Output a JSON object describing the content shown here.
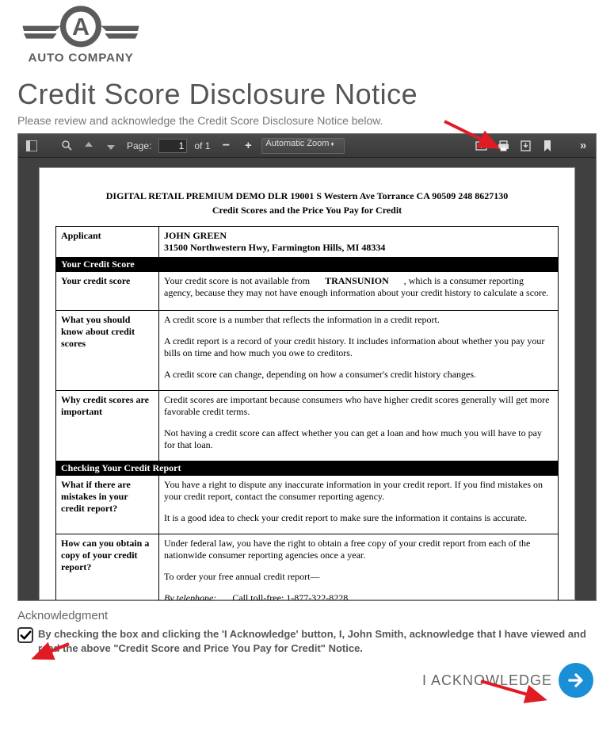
{
  "brand": {
    "name": "AUTO COMPANY"
  },
  "page": {
    "title": "Credit Score Disclosure Notice",
    "subtitle": "Please review and acknowledge the Credit Score Disclosure Notice below."
  },
  "pdfToolbar": {
    "pageLabel": "Page:",
    "pageCurrent": "1",
    "pageOf": "of 1",
    "zoom": "Automatic Zoom"
  },
  "doc": {
    "header1": "DIGITAL RETAIL PREMIUM DEMO DLR 19001 S Western Ave Torrance CA 90509 248 8627130",
    "header2": "Credit Scores and the Price You Pay for Credit",
    "applicantLabel": "Applicant",
    "applicantName": "JOHN GREEN",
    "applicantAddr": "31500 Northwestern Hwy, Farmington Hills, MI 48334",
    "section1": "Your Credit Score",
    "r1Label": "Your credit score",
    "r1p1a": "Your credit score is not available from ",
    "r1Agency": "TRANSUNION",
    "r1p1b": " , which is a consumer reporting agency, because they may not have enough information about your credit history to calculate a score.",
    "r2Label": "What you should know about credit scores",
    "r2p1": "A credit score is a number that reflects the information in a credit report.",
    "r2p2": "A credit report is a record of your credit history.  It includes information about whether you pay your bills on time and how much you owe to creditors.",
    "r2p3": "A credit score can change, depending on how a consumer's credit history changes.",
    "r3Label": "Why credit scores are important",
    "r3p1": "Credit scores are important because consumers who have higher credit scores generally will get more favorable credit terms.",
    "r3p2": "Not having a credit score can affect whether you can get a loan and how much you will have to pay for that loan.",
    "section2": "Checking Your Credit Report",
    "r4Label": "What if there are mistakes in your credit report?",
    "r4p1": "You have a right to dispute any inaccurate information in your credit report.  If you find mistakes on your credit report, contact the consumer reporting agency.",
    "r4p2": "It is a good idea to check your credit report to make sure the information it contains is accurate.",
    "r5Label": "How can you obtain a copy of your credit report?",
    "r5p1": "Under federal law, you have the right to obtain a free copy of your credit report from each of the nationwide consumer reporting agencies once a year.",
    "r5p2": "To order your free annual credit report—",
    "r5p3lbl": "By telephone:",
    "r5p3txt": "Call toll-free:  1-877-322-8228"
  },
  "ack": {
    "title": "Acknowledgment",
    "checked": true,
    "text": "By checking the box and clicking the 'I Acknowledge' button, I, John Smith, acknowledge that I have viewed and read the above \"Credit Score and Price You Pay for Credit\" Notice.",
    "button": "I ACKNOWLEDGE"
  },
  "colors": {
    "accent": "#1b8fd6",
    "arrow": "#e01b24"
  }
}
